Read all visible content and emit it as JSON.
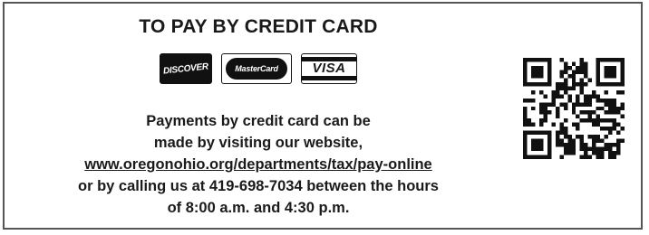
{
  "title": "TO PAY BY CREDIT CARD",
  "cards": {
    "discover": "DISCOVER",
    "mastercard": "MasterCard",
    "visa": "VISA"
  },
  "body": {
    "line1": "Payments by credit card can be",
    "line2": "made by visiting our website,",
    "link": "www.oregonohio.org/departments/tax/pay-online",
    "line3": "or by calling us at 419-698-7034 between the hours",
    "line4": "of 8:00 a.m. and 4:30 p.m."
  },
  "qr_code": "qr-code-icon"
}
